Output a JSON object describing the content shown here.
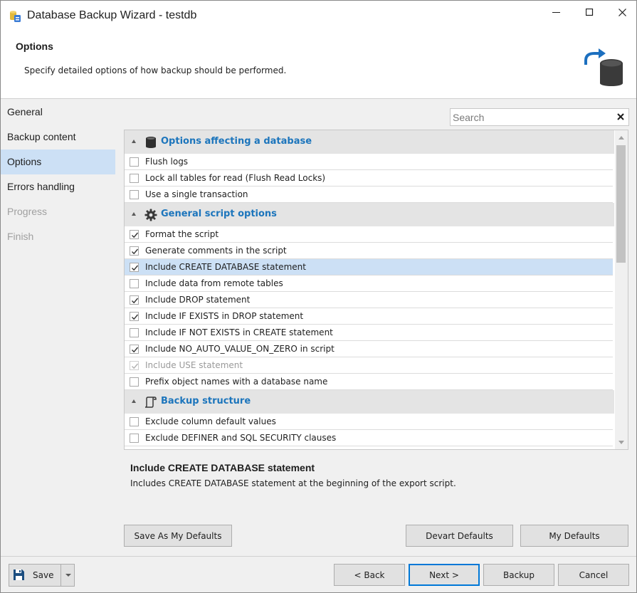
{
  "window": {
    "title": "Database Backup Wizard - testdb"
  },
  "header": {
    "title": "Options",
    "description": "Specify detailed options of how backup should be performed."
  },
  "nav": {
    "items": [
      {
        "label": "General",
        "state": "normal"
      },
      {
        "label": "Backup content",
        "state": "normal"
      },
      {
        "label": "Options",
        "state": "active"
      },
      {
        "label": "Errors handling",
        "state": "normal"
      },
      {
        "label": "Progress",
        "state": "disabled"
      },
      {
        "label": "Finish",
        "state": "disabled"
      }
    ]
  },
  "search": {
    "placeholder": "Search"
  },
  "groups": [
    {
      "label": "Options affecting a database",
      "icon": "database-icon",
      "items": [
        {
          "label": "Flush logs",
          "checked": false
        },
        {
          "label": "Lock all tables for read (Flush Read Locks)",
          "checked": false
        },
        {
          "label": "Use a single transaction",
          "checked": false
        }
      ]
    },
    {
      "label": "General script options",
      "icon": "gear-icon",
      "items": [
        {
          "label": "Format the script",
          "checked": true
        },
        {
          "label": "Generate comments in the script",
          "checked": true
        },
        {
          "label": "Include CREATE DATABASE statement",
          "checked": true,
          "selected": true
        },
        {
          "label": "Include data from remote tables",
          "checked": false
        },
        {
          "label": "Include DROP statement",
          "checked": true
        },
        {
          "label": "Include IF EXISTS in DROP statement",
          "checked": true
        },
        {
          "label": "Include IF NOT EXISTS in CREATE statement",
          "checked": false
        },
        {
          "label": "Include NO_AUTO_VALUE_ON_ZERO in script",
          "checked": true
        },
        {
          "label": "Include USE statement",
          "checked": true,
          "disabled": true
        },
        {
          "label": "Prefix object names with a database name",
          "checked": false
        }
      ]
    },
    {
      "label": "Backup structure",
      "icon": "script-icon",
      "items": [
        {
          "label": "Exclude column default values",
          "checked": false
        },
        {
          "label": "Exclude DEFINER and SQL SECURITY clauses",
          "checked": false
        }
      ]
    }
  ],
  "description": {
    "title": "Include CREATE DATABASE statement",
    "text": "Includes CREATE DATABASE statement at the beginning of the export script."
  },
  "buttons": {
    "save_as_defaults": "Save As My Defaults",
    "devart_defaults": "Devart Defaults",
    "my_defaults": "My Defaults"
  },
  "footer": {
    "save": "Save",
    "back": "< Back",
    "next": "Next >",
    "backup": "Backup",
    "cancel": "Cancel"
  },
  "colors": {
    "accent": "#1c75bc",
    "selection": "#cce0f5",
    "primary_border": "#0078d7"
  }
}
